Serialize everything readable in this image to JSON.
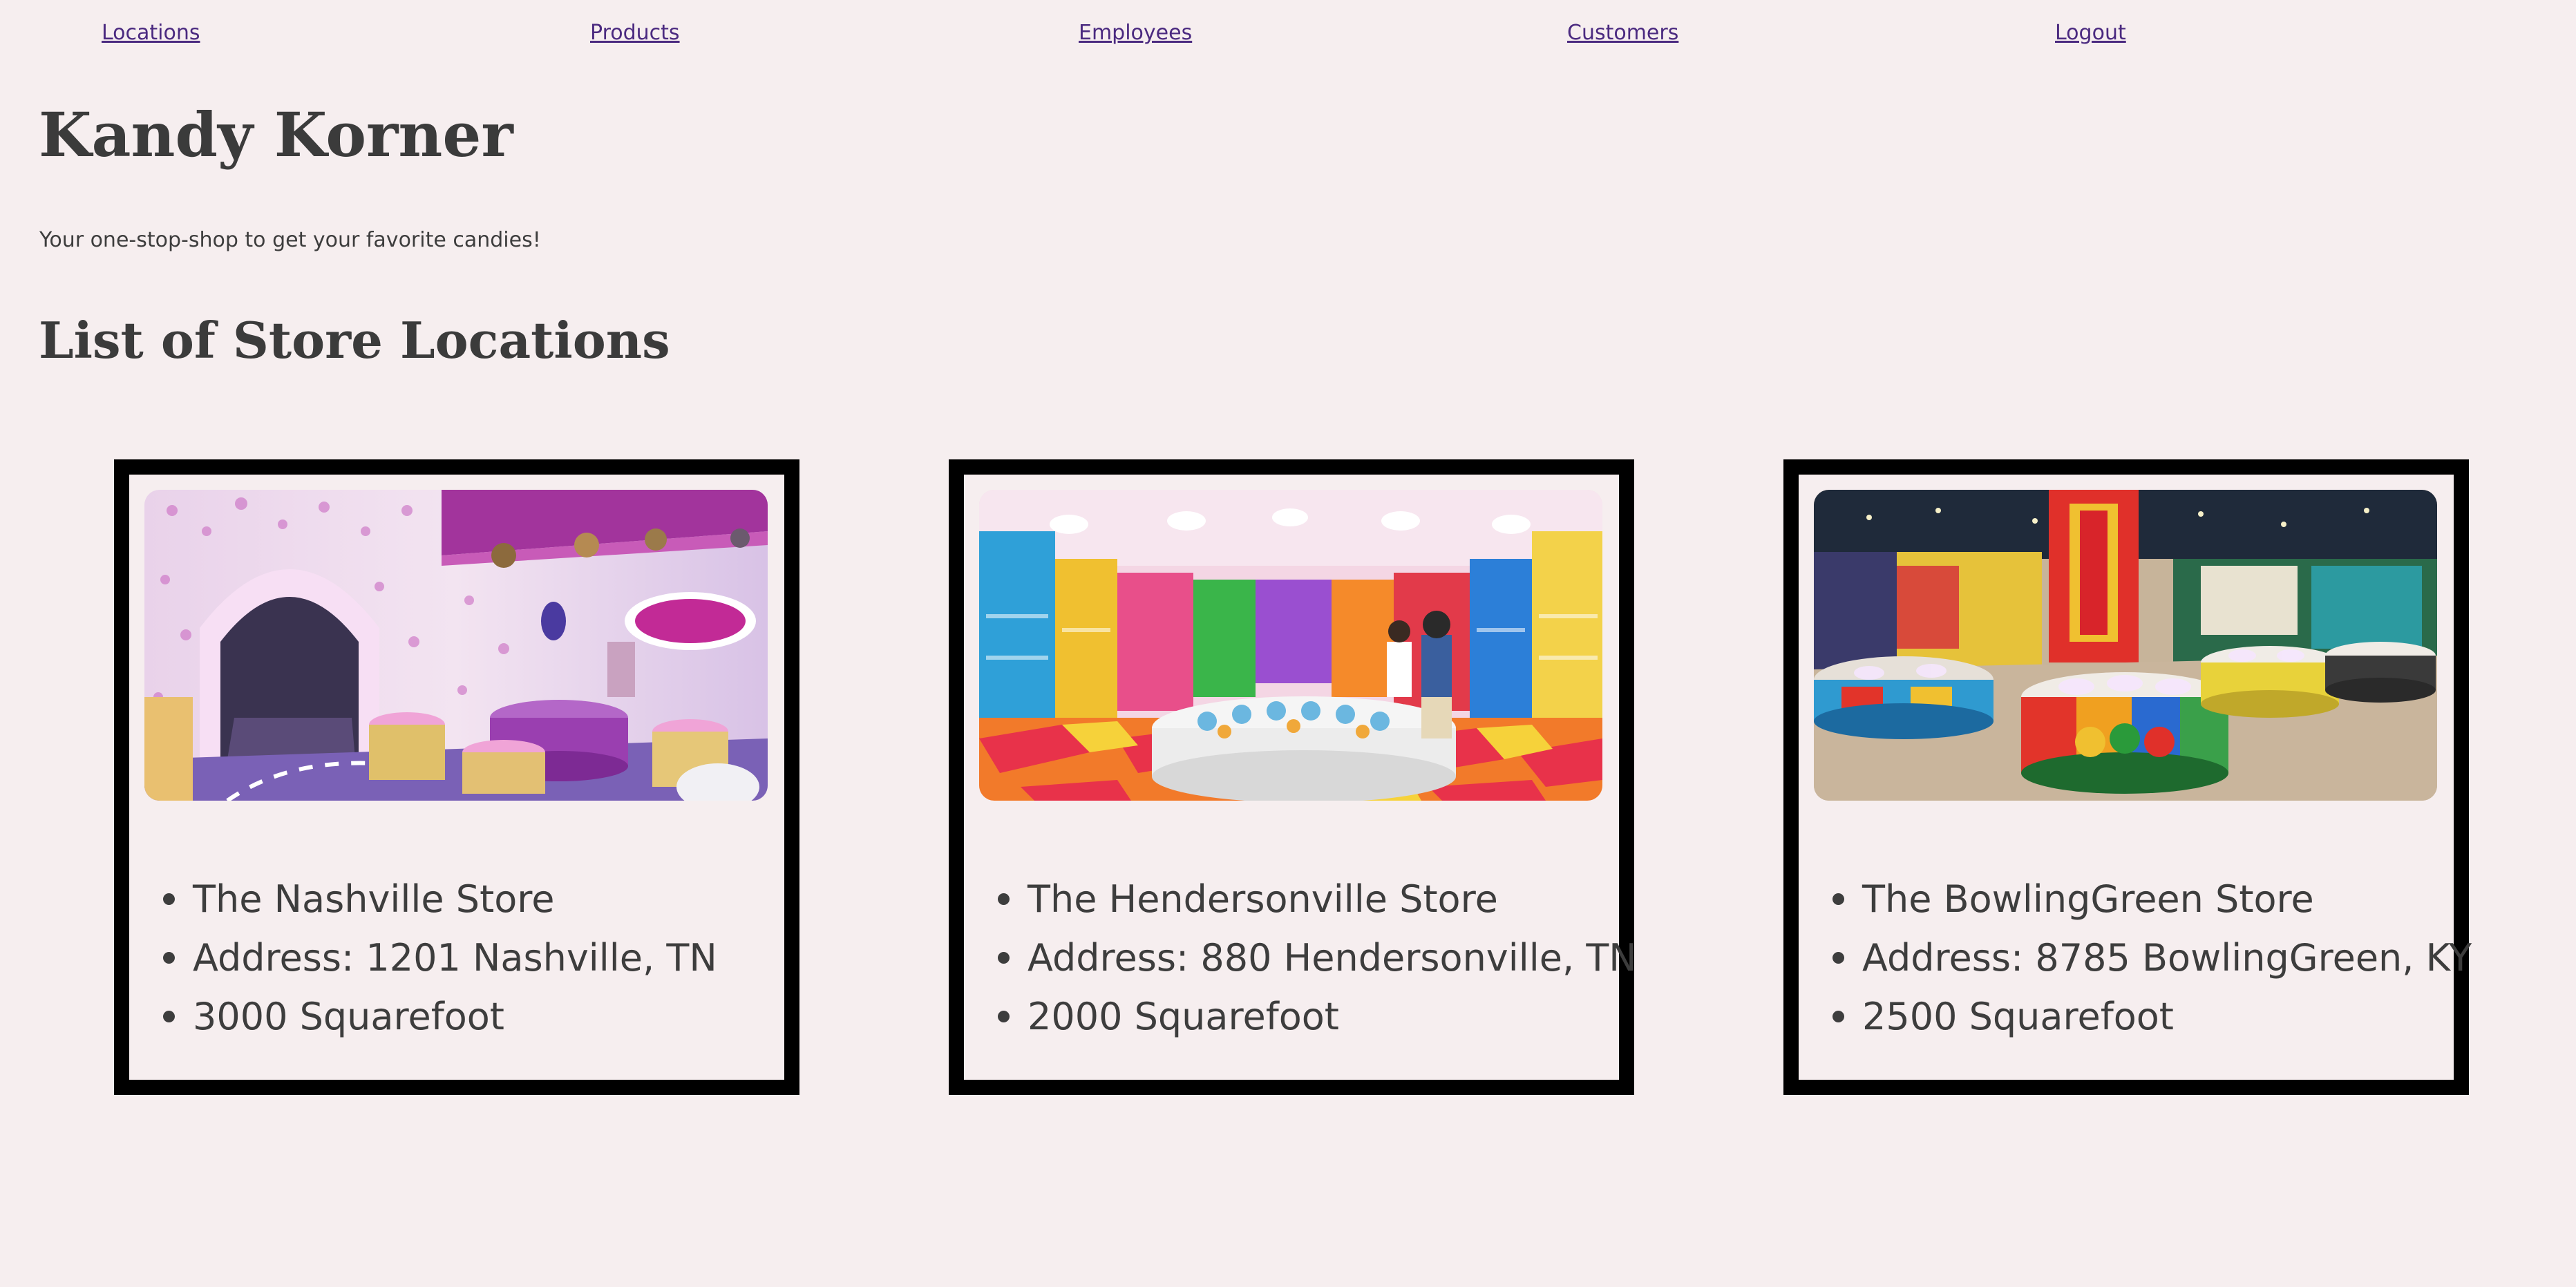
{
  "nav": {
    "locations": "Locations",
    "products": "Products",
    "employees": "Employees",
    "customers": "Customers",
    "logout": "Logout"
  },
  "header": {
    "title": "Kandy Korner",
    "tagline": "Your one-stop-shop to get your favorite candies!"
  },
  "locations_heading": "List of Store Locations",
  "stores": [
    {
      "name": "The Nashville Store",
      "address": "Address: 1201 Nashville, TN",
      "size": "3000 Squarefoot",
      "image": "candy-store-interior-photo"
    },
    {
      "name": "The Hendersonville Store",
      "address": "Address: 880 Hendersonville, TN",
      "size": "2000 Squarefoot",
      "image": "candy-store-interior-photo"
    },
    {
      "name": "The BowlingGreen Store",
      "address": "Address: 8785 BowlingGreen, KY",
      "size": "2500 Squarefoot",
      "image": "candy-store-interior-photo"
    }
  ],
  "colors": {
    "background": "#f6eeef",
    "link": "#4b2a80",
    "text": "#3d3d3d",
    "card_border": "#000000"
  }
}
